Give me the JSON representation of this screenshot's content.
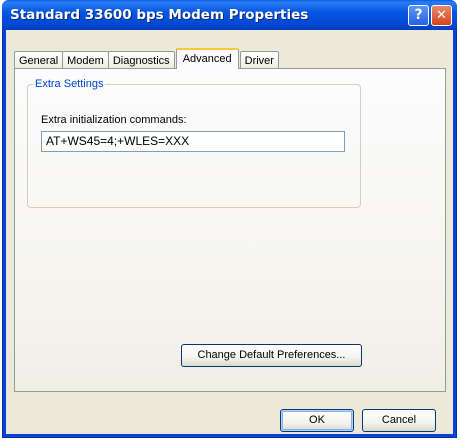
{
  "window": {
    "title": "Standard 33600 bps Modem Properties",
    "help_glyph": "?",
    "close_glyph": "✕"
  },
  "tabs": [
    {
      "label": "General",
      "active": false
    },
    {
      "label": "Modem",
      "active": false
    },
    {
      "label": "Diagnostics",
      "active": false
    },
    {
      "label": "Advanced",
      "active": true
    },
    {
      "label": "Driver",
      "active": false
    }
  ],
  "extra_settings": {
    "legend": "Extra Settings",
    "field_label": "Extra initialization commands:",
    "field_value": "AT+WS45=4;+WLES=XXX"
  },
  "buttons": {
    "change_defaults": "Change Default Preferences...",
    "ok": "OK",
    "cancel": "Cancel"
  },
  "colors": {
    "titlebar": "#0654e0",
    "dialog_face": "#ece9d8",
    "group_legend": "#0046d5",
    "close_button": "#d2441f"
  }
}
